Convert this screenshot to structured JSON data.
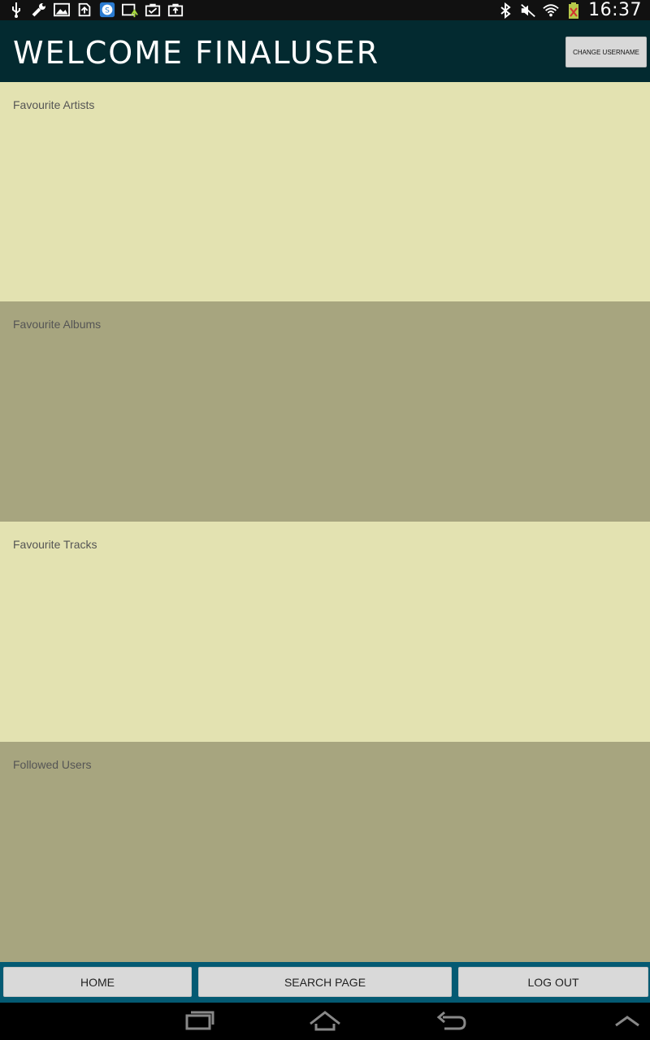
{
  "status_bar": {
    "time": "16:37",
    "left_icons": [
      "usb-icon",
      "wrench-icon",
      "image-icon",
      "upload-file-icon",
      "skype-icon",
      "upload-arrow-icon",
      "clipboard-check-icon",
      "briefcase-upload-icon"
    ],
    "right_icons": [
      "bluetooth-icon",
      "mute-icon",
      "wifi-icon",
      "battery-icon"
    ]
  },
  "header": {
    "title": "WELCOME FINALUSER",
    "change_username": "CHANGE USERNAME",
    "background": "#032a30"
  },
  "sections": [
    {
      "label": "Favourite Artists",
      "color": "#e3e2b1"
    },
    {
      "label": "Favourite Albums",
      "color": "#a7a57f"
    },
    {
      "label": "Favourite Tracks",
      "color": "#e3e2b1"
    },
    {
      "label": "Followed Users",
      "color": "#a7a57f"
    }
  ],
  "bottom_nav": {
    "home": "HOME",
    "search": "SEARCH PAGE",
    "logout": "LOG OUT",
    "background": "#045a73"
  },
  "system_nav": [
    "recents-icon",
    "home-icon",
    "back-icon",
    "up-chevron-icon"
  ]
}
